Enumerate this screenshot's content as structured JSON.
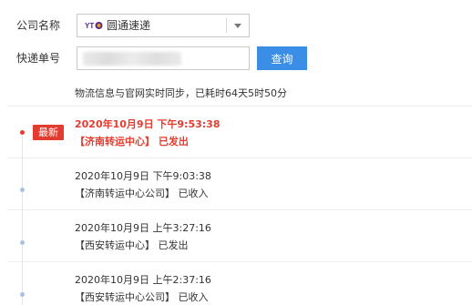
{
  "form": {
    "company_label": "公司名称",
    "company_value": "圆通速递",
    "company_logo": "yto-logo",
    "tracking_label": "快递单号",
    "tracking_value": "",
    "query_button": "查询",
    "accent_color": "#3a8ee6"
  },
  "sync_note": "物流信息与官网实时同步，已耗时64天5时50分",
  "latest_badge": "最新",
  "latest_color": "#e33b2e",
  "entries": [
    {
      "time": "2020年10月9日 下午9:53:38",
      "status": "【济南转运中心】 已发出"
    },
    {
      "time": "2020年10月9日 下午9:03:38",
      "status": "【济南转运中心公司】 已收入"
    },
    {
      "time": "2020年10月9日 上午3:27:16",
      "status": "【西安转运中心】 已发出"
    },
    {
      "time": "2020年10月9日 上午2:37:16",
      "status": "【西安转运中心公司】 已收入"
    }
  ]
}
